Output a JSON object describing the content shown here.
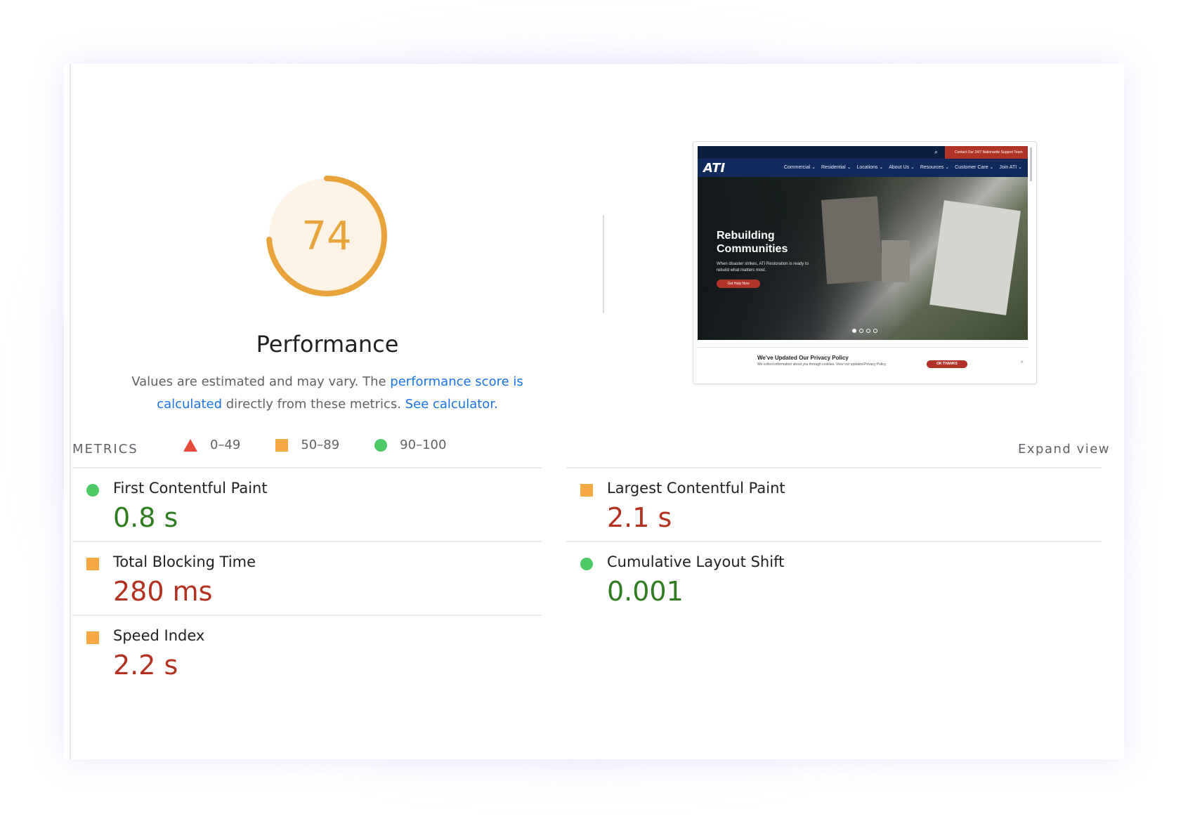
{
  "performance": {
    "score": "74",
    "score_fraction": 0.74,
    "title": "Performance",
    "desc_prefix": "Values are estimated and may vary. The ",
    "desc_link1": "performance score is calculated",
    "desc_middle": " directly from these metrics. ",
    "desc_link2": "See calculator.",
    "accent_color": "#e8a33a"
  },
  "legend": [
    {
      "icon": "red-triangle-icon",
      "label": "0–49"
    },
    {
      "icon": "orange-square-icon",
      "label": "50–89"
    },
    {
      "icon": "green-circle-icon",
      "label": "90–100"
    }
  ],
  "thumbnail": {
    "logo": "ATI",
    "topbar_text": "Contact Our 24/7 Nationwide Support Team",
    "nav": [
      "Commercial ⌄",
      "Residential ⌄",
      "Locations ⌄",
      "About Us ⌄",
      "Resources ⌄",
      "Customer Care ⌄",
      "Join ATI ⌄"
    ],
    "hero_title_1": "Rebuilding",
    "hero_title_2": "Communities",
    "hero_sub": "When disaster strikes, ATI Restoration is ready to rebuild what matters most.",
    "hero_button": "Get Help Now",
    "privacy_title": "We've Updated Our Privacy Policy",
    "privacy_text": "We collect information about you through cookies. View our updated Privacy Policy",
    "privacy_button": "OK THANKS",
    "privacy_close": "×"
  },
  "metrics": {
    "section_label": "METRICS",
    "expand_label": "Expand view",
    "items": [
      {
        "name": "First Contentful Paint",
        "value": "0.8 s",
        "rating": "good"
      },
      {
        "name": "Largest Contentful Paint",
        "value": "2.1 s",
        "rating": "average"
      },
      {
        "name": "Total Blocking Time",
        "value": "280 ms",
        "rating": "average"
      },
      {
        "name": "Cumulative Layout Shift",
        "value": "0.001",
        "rating": "good"
      },
      {
        "name": "Speed Index",
        "value": "2.2 s",
        "rating": "average"
      }
    ]
  },
  "colors": {
    "good": "#2e7d1e",
    "average": "#b3311e",
    "link": "#1a73e8",
    "fail_icon": "#e54a3a",
    "average_icon": "#f5a742",
    "pass_icon": "#4cc964"
  }
}
